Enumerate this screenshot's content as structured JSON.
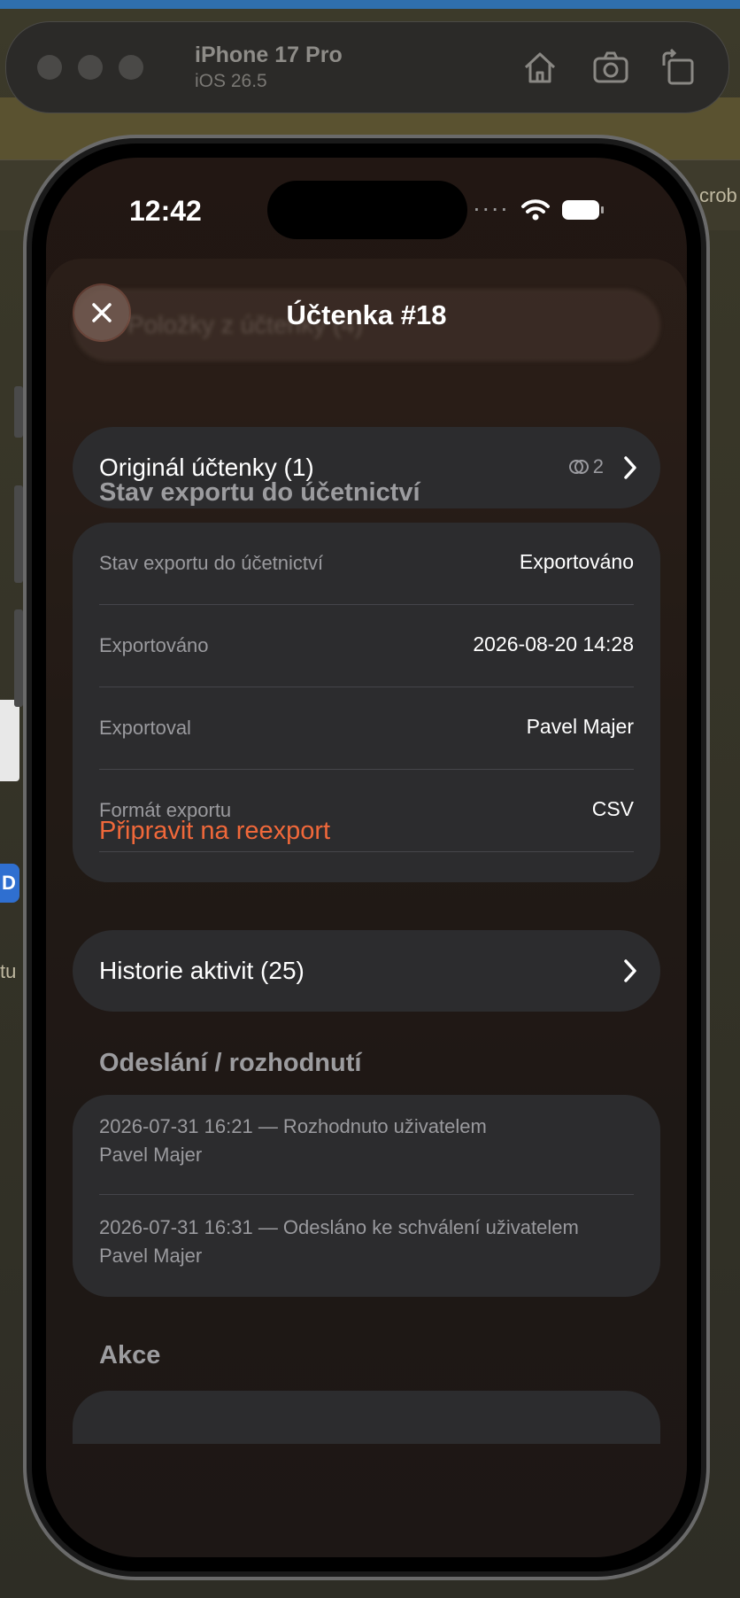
{
  "simulator": {
    "device_name": "iPhone 17 Pro",
    "os_version": "iOS 26.5",
    "edge_text_right": "crob",
    "edge_text_left": "tu",
    "edge_badge": "D"
  },
  "status_bar": {
    "time": "12:42",
    "signal_dots": "····"
  },
  "sheet": {
    "title": "Účtenka #18",
    "ghost_row_label": "Položky z účtenky (4)"
  },
  "original_receipt": {
    "label": "Originál účtenky (1)",
    "count": "2"
  },
  "export_section": {
    "heading": "Stav exportu do účetnictví",
    "rows": [
      {
        "label": "Stav exportu do účetnictví",
        "value": "Exportováno"
      },
      {
        "label": "Exportováno",
        "value": "2026-08-20 14:28"
      },
      {
        "label": "Exportoval",
        "value": "Pavel Majer"
      },
      {
        "label": "Formát exportu",
        "value": "CSV"
      }
    ],
    "action": "Připravit na reexport"
  },
  "activity_history": {
    "label": "Historie aktivit (25)"
  },
  "decisions_section": {
    "heading": "Odeslání / rozhodnutí",
    "entries": [
      {
        "line1": "2026-07-31 16:21 — Rozhodnuto uživatelem",
        "line2": "Pavel Majer"
      },
      {
        "line1": "2026-07-31 16:31 — Odesláno ke schválení uživatelem",
        "line2": "Pavel Majer"
      }
    ]
  },
  "actions_section": {
    "heading": "Akce"
  },
  "colors": {
    "accent_action": "#f0683a",
    "card_bg": "#2c2c2e"
  }
}
